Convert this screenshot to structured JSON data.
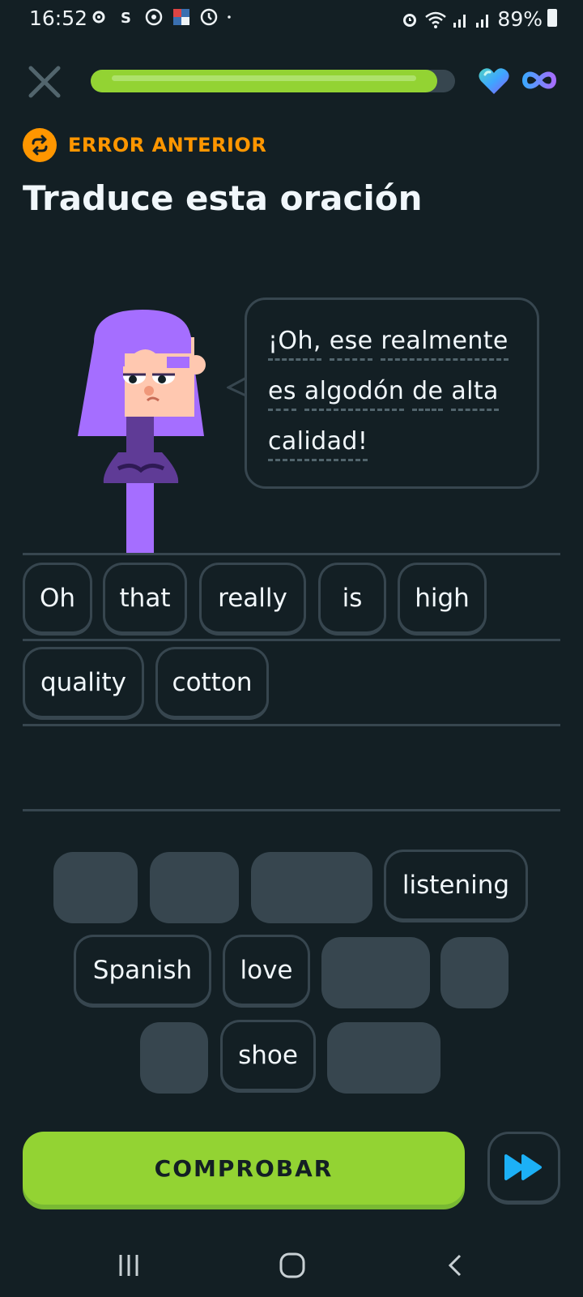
{
  "status_bar": {
    "time": "16:52",
    "battery": "89%"
  },
  "header": {
    "progress": 0.95,
    "hearts": "heart-icon",
    "infinity": "infinity-icon"
  },
  "prev_error": {
    "label": "ERROR ANTERIOR"
  },
  "title": "Traduce esta oración",
  "bubble": {
    "lines": [
      [
        "¡Oh,",
        "ese",
        "realmente"
      ],
      [
        "es",
        "algodón",
        "de",
        "alta"
      ],
      [
        "calidad!"
      ]
    ]
  },
  "answer_tiles": [
    {
      "label": "Oh"
    },
    {
      "label": "that"
    },
    {
      "label": "really"
    },
    {
      "label": "is"
    },
    {
      "label": "high"
    },
    {
      "label": "quality"
    },
    {
      "label": "cotton"
    }
  ],
  "word_bank": [
    {
      "label": "listening"
    },
    {
      "label": "Spanish"
    },
    {
      "label": "love"
    },
    {
      "label": "shoe"
    }
  ],
  "check_button": {
    "label": "COMPROBAR"
  },
  "colors": {
    "background": "#131f24",
    "accent_green": "#93d333",
    "accent_orange": "#ff9600",
    "border": "#37464f",
    "character_purple": "#a56eff"
  }
}
